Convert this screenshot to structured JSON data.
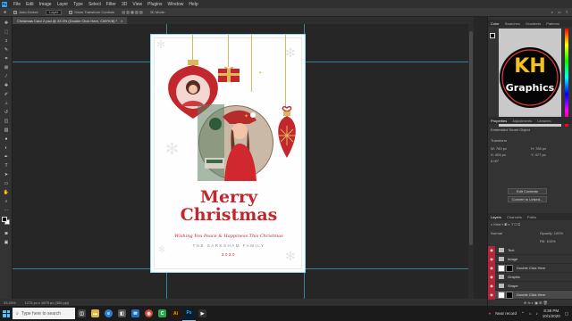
{
  "menu": {
    "items": [
      "File",
      "Edit",
      "Image",
      "Layer",
      "Type",
      "Select",
      "Filter",
      "3D",
      "View",
      "Plugins",
      "Window",
      "Help"
    ]
  },
  "options": {
    "auto_select": "Auto-Select:",
    "layer_select": "Layer",
    "show_transform": "Show Transform Controls",
    "mode_3d": "3D Mode:"
  },
  "document": {
    "tab_title": "Christmas Card 2.psd @ 33.3% (Double Click Here, CMYK/8) *"
  },
  "status": {
    "zoom": "33.33%",
    "doc_size": "1275 px x 1875 px (300 ppi)"
  },
  "card": {
    "title_line1": "Merry",
    "title_line2": "Christmas",
    "wish": "Wishing You Peace & Happiness This Christmas",
    "family": "THE SARKSHAM FAMILY",
    "year": "2020",
    "accent": "#c1272d",
    "gold": "#e0b65a"
  },
  "panels": {
    "color_tabs": [
      "Color",
      "Swatches",
      "Gradients",
      "Patterns"
    ],
    "logo_line1": "KH",
    "logo_line2": "Graphics",
    "properties_tabs": [
      "Properties",
      "Adjustments",
      "Libraries"
    ],
    "smart_object": "Embedded Smart Object",
    "transform_label": "Transform",
    "w_value": "W: 783 px",
    "h_value": "H: 783 px",
    "x_value": "X: 404 px",
    "y_value": "Y: 477 px",
    "angle": "0.00°",
    "edit_contents": "Edit Contents",
    "convert_linked": "Convert to Linked...",
    "layers_tabs": [
      "Layers",
      "Channels",
      "Paths"
    ],
    "blend_mode": "Normal",
    "opacity": "Opacity: 100%",
    "fill": "Fill: 100%",
    "layers": [
      {
        "name": "Text",
        "kind": "folder"
      },
      {
        "name": "Image",
        "kind": "folder"
      },
      {
        "name": "Double Click Here",
        "kind": "smart"
      },
      {
        "name": "Graphic",
        "kind": "folder"
      },
      {
        "name": "Shape",
        "kind": "folder"
      },
      {
        "name": "Double Click Here",
        "kind": "smart"
      }
    ]
  },
  "taskbar": {
    "search_placeholder": "Type here to search",
    "recording": "Near record",
    "time": "8:39 PM",
    "date": "10/1/2020"
  }
}
